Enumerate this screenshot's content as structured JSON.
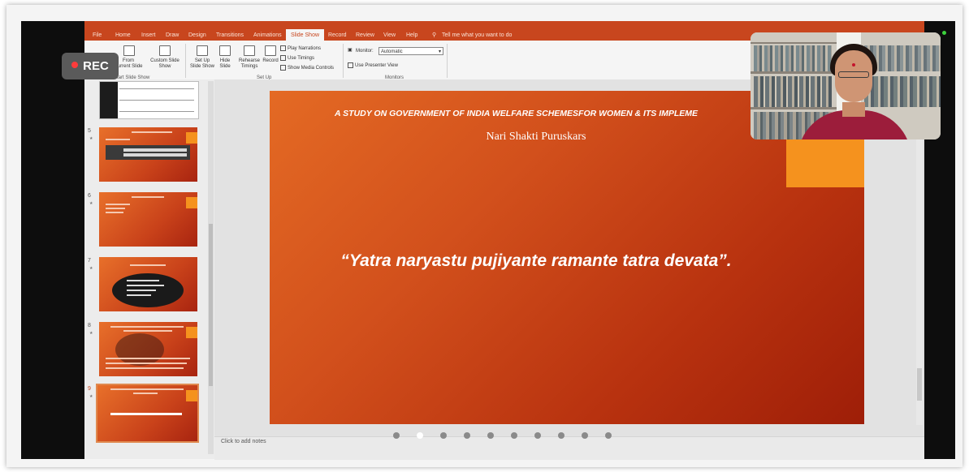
{
  "recording": {
    "label": "REC"
  },
  "ribbon": {
    "tabs": [
      "File",
      "Home",
      "Insert",
      "Draw",
      "Design",
      "Transitions",
      "Animations",
      "Slide Show",
      "Record",
      "Review",
      "View",
      "Help"
    ],
    "active_tab": "Slide Show",
    "search_placeholder": "Tell me what you want to do",
    "buttons": {
      "from_current": "From\nCurrent Slide",
      "custom_show": "Custom Slide\nShow",
      "setup_show": "Set Up\nSlide Show",
      "hide_slide": "Hide\nSlide",
      "rehearse": "Rehearse\nTimings",
      "record": "Record"
    },
    "checkboxes": [
      "Play Narrations",
      "Use Timings",
      "Show Media Controls"
    ],
    "monitor_label": "Monitor:",
    "monitor_value": "Automatic",
    "presenter_view": "Use Presenter View",
    "groups": {
      "start": "Start Slide Show",
      "setup": "Set Up",
      "monitors": "Monitors"
    }
  },
  "thumbnails": [
    {
      "num": "",
      "top": 0
    },
    {
      "num": "5"
    },
    {
      "num": "6"
    },
    {
      "num": "7"
    },
    {
      "num": "8"
    },
    {
      "num": "9"
    }
  ],
  "slide": {
    "title": "A STUDY ON GOVERNMENT OF INDIA WELFARE SCHEMESFOR WOMEN & ITS IMPLEME",
    "subtitle": "Nari Shakti Puruskars",
    "quote": "“Yatra naryastu pujiyante ramante tatra devata”."
  },
  "notes": {
    "placeholder": "Click to add notes"
  },
  "pager": {
    "count": 10,
    "active_index": 1
  },
  "colors": {
    "accent": "#c8461e",
    "slide_orange": "#e46a24",
    "slide_red": "#9e1e08",
    "accent_square": "#f5921e"
  }
}
